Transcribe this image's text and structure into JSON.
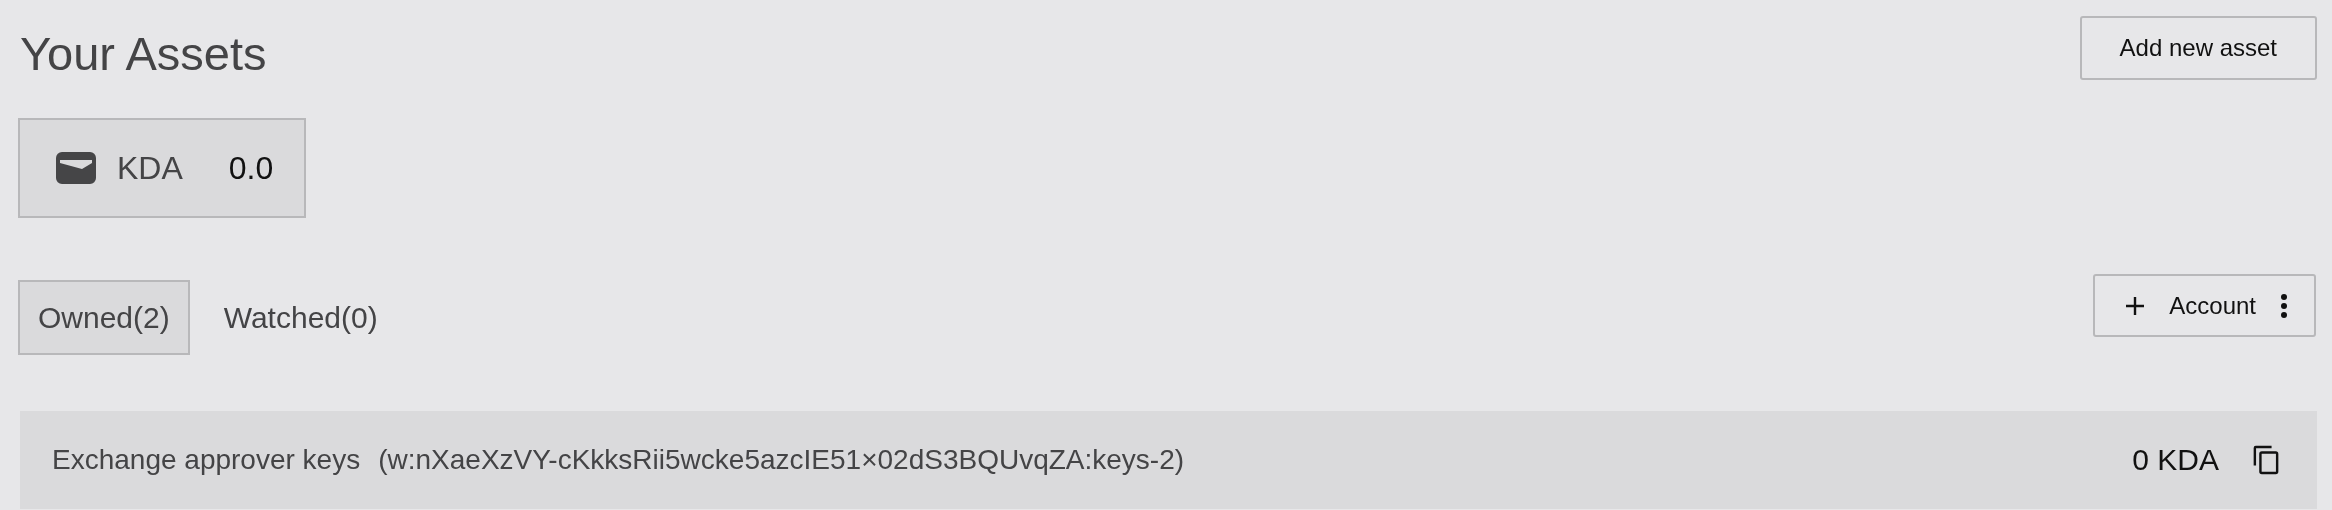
{
  "header": {
    "title": "Your Assets",
    "add_button": "Add new asset"
  },
  "balances": [
    {
      "token": "KDA",
      "amount": "0.0"
    }
  ],
  "tabs": [
    {
      "label": "Owned(2)",
      "selected": true
    },
    {
      "label": "Watched(0)",
      "selected": false
    }
  ],
  "account_button": {
    "label": "Account"
  },
  "accounts": [
    {
      "name": "Exchange approver keys",
      "address": "(w:nXaeXzVY-cKkksRii5wcke5azcIE51×02dS3BQUvqZA:keys-2)",
      "balance": "0 KDA"
    }
  ]
}
